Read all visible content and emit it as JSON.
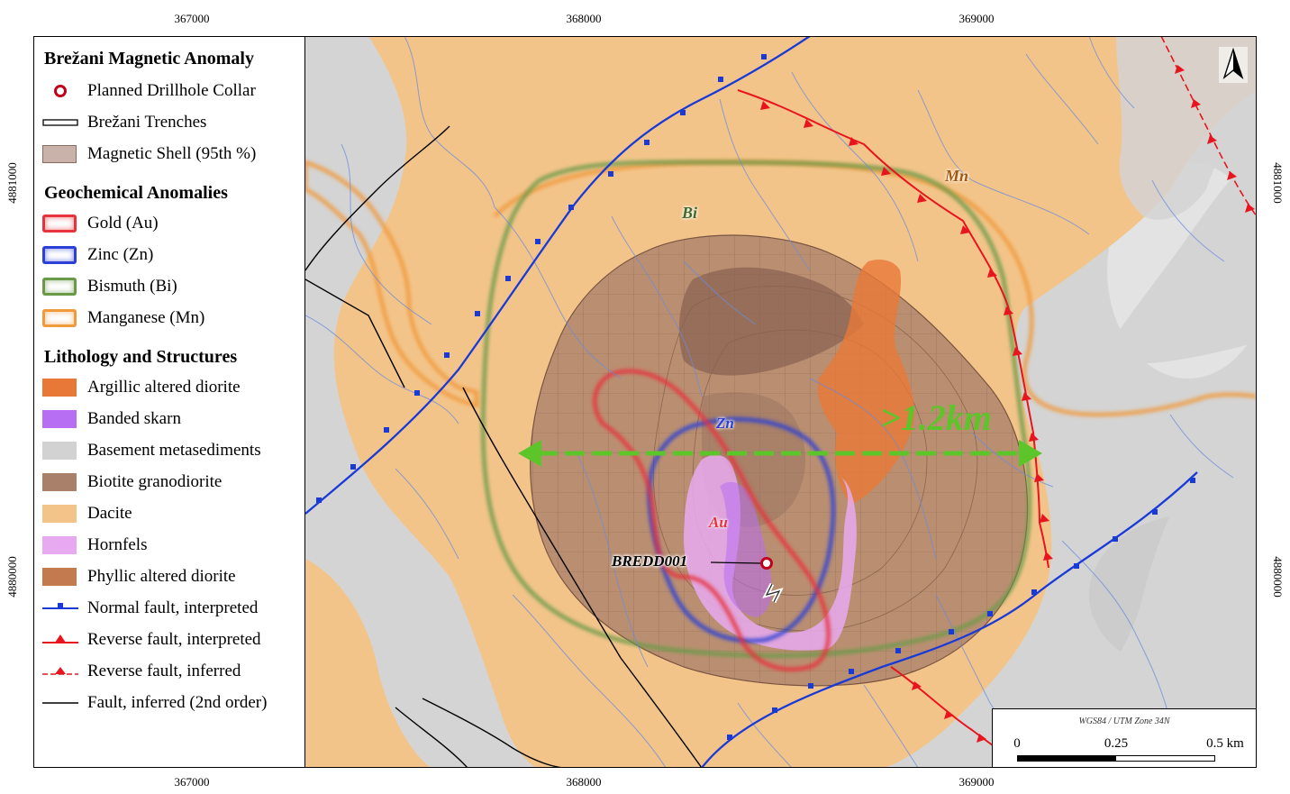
{
  "map": {
    "easting_ticks": [
      "367000",
      "368000",
      "369000"
    ],
    "northing_ticks": [
      "4881000",
      "4880000"
    ],
    "north_arrow": "north-arrow-icon"
  },
  "legend": {
    "title": "Brežani Magnetic Anomaly",
    "general": [
      {
        "label": "Planned Drillhole Collar",
        "symbol": "collar-circle-icon",
        "color": "#c0001a"
      },
      {
        "label": "Brežani Trenches",
        "symbol": "trench-line-icon",
        "color": "#000000"
      },
      {
        "label": "Magnetic Shell (95th %)",
        "symbol": "shell-fill",
        "color": "#c9b2aa"
      }
    ],
    "geochem_title": "Geochemical Anomalies",
    "geochem": [
      {
        "label": "Gold (Au)",
        "color": "#e8323c"
      },
      {
        "label": "Zinc (Zn)",
        "color": "#2c3fd6"
      },
      {
        "label": "Bismuth (Bi)",
        "color": "#6a9a48"
      },
      {
        "label": "Manganese (Mn)",
        "color": "#f09a3c"
      }
    ],
    "litho_title": "Lithology and Structures",
    "lithology": [
      {
        "label": "Argillic altered diorite",
        "color": "#e87838"
      },
      {
        "label": "Banded skarn",
        "color": "#b86ef2"
      },
      {
        "label": "Basement metasediments",
        "color": "#d2d2d2"
      },
      {
        "label": "Biotite granodiorite",
        "color": "#a9806a"
      },
      {
        "label": "Dacite",
        "color": "#f3c48a"
      },
      {
        "label": "Hornfels",
        "color": "#e7aaf0"
      },
      {
        "label": "Phyllic altered diorite",
        "color": "#c27a4e"
      }
    ],
    "structures": [
      {
        "label": "Normal fault, interpreted",
        "style": "normal-fault",
        "color": "#1a3ad8"
      },
      {
        "label": "Reverse fault, interpreted",
        "style": "reverse-fault",
        "color": "#e8141e"
      },
      {
        "label": "Reverse fault, inferred",
        "style": "reverse-fault-dashed",
        "color": "#e8141e"
      },
      {
        "label": "Fault, inferred (2nd order)",
        "style": "thin-fault",
        "color": "#000000"
      }
    ]
  },
  "annotations": {
    "bi": "Bi",
    "mn": "Mn",
    "zn": "Zn",
    "au": "Au",
    "span": ">1.2km",
    "drillhole": "BREDD001"
  },
  "scale": {
    "crs": "WGS84 / UTM Zone 34N",
    "labels": [
      "0",
      "0.25",
      "0.5 km"
    ]
  }
}
